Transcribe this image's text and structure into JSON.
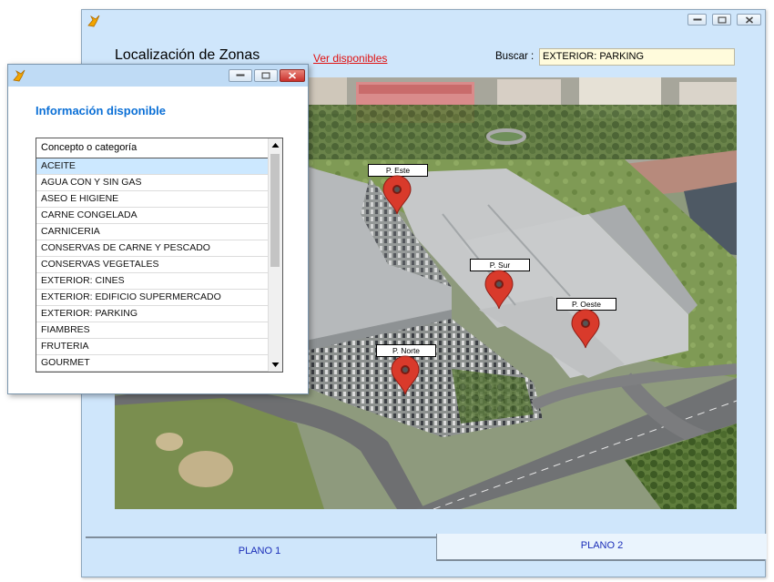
{
  "main_window": {
    "title": "Localización de Zonas",
    "link": "Ver disponibles",
    "search": {
      "label": "Buscar :",
      "value": "EXTERIOR: PARKING"
    },
    "map": {
      "markers": [
        {
          "label": "P. Este"
        },
        {
          "label": "P. Sur"
        },
        {
          "label": "P. Oeste"
        },
        {
          "label": "P. Norte"
        }
      ]
    },
    "tabs": [
      {
        "label": "PLANO 1",
        "active": false
      },
      {
        "label": "PLANO 2",
        "active": true
      }
    ]
  },
  "popup": {
    "heading": "Información disponible",
    "list": {
      "column_header": "Concepto o categoría",
      "selected": "ACEITE",
      "items": [
        "ACEITE",
        "AGUA CON Y SIN GAS",
        "ASEO E HIGIENE",
        "CARNE CONGELADA",
        "CARNICERIA",
        "CONSERVAS DE CARNE Y PESCADO",
        "CONSERVAS VEGETALES",
        "EXTERIOR: CINES",
        "EXTERIOR: EDIFICIO SUPERMERCADO",
        "EXTERIOR: PARKING",
        "FIAMBRES",
        "FRUTERIA",
        "GOURMET"
      ]
    }
  },
  "colors": {
    "window_bg": "#cfe6fb",
    "accent_heading": "#0a6fd6",
    "link": "#e01010",
    "tab_text": "#1a2db8",
    "selected_row": "#cce8ff",
    "search_bg": "#fffbdc",
    "marker": "#d93a2b",
    "close_button": "#c9302c"
  },
  "icons": [
    "app-bird-icon",
    "minimize-icon",
    "maximize-icon",
    "close-icon",
    "map-pin-icon",
    "scroll-up-icon",
    "scroll-down-icon"
  ]
}
